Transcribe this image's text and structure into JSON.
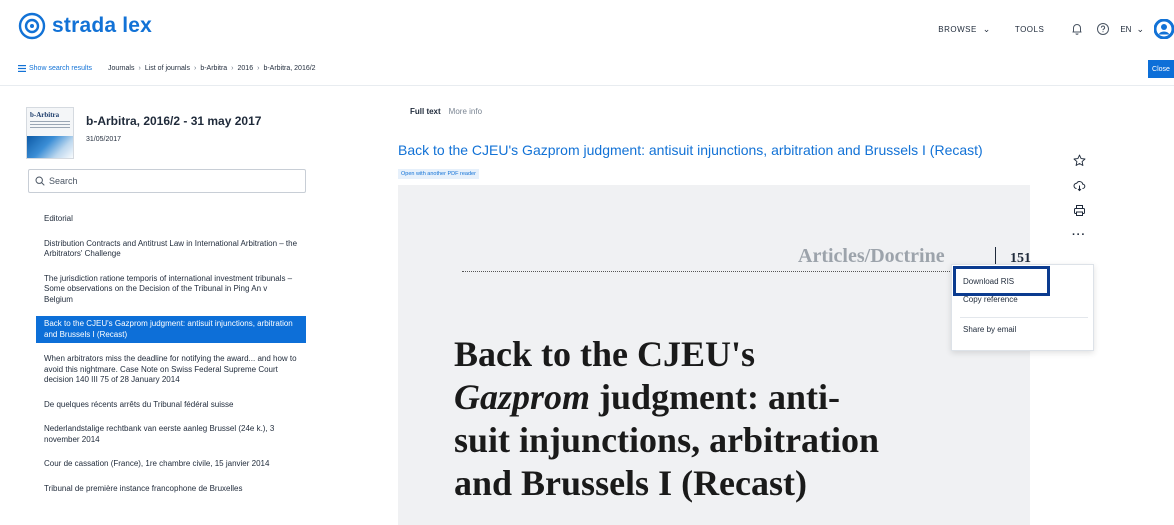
{
  "brand": {
    "name": "strada lex",
    "color": "#1272d6"
  },
  "topnav": {
    "browse": "BROWSE",
    "tools": "TOOLS",
    "language": "EN"
  },
  "breadcrumb": {
    "show_results": "Show search results",
    "items": [
      "Journals",
      "List of journals",
      "b-Arbitra",
      "2016",
      "b-Arbitra, 2016/2"
    ],
    "close_label": "Close"
  },
  "journal": {
    "cover_title": "b-Arbitra",
    "title": "b-Arbitra, 2016/2 - 31 may 2017",
    "date": "31/05/2017"
  },
  "search": {
    "placeholder": "Search"
  },
  "toc": [
    "Editorial",
    "Distribution Contracts and Antitrust Law in International Arbitration – the Arbitrators' Challenge",
    "The jurisdiction ratione temporis of international investment tribunals – Some observations on the Decision of the Tribunal in Ping An v Belgium",
    "Back to the CJEU's Gazprom judgment: antisuit injunctions, arbitration and Brussels I (Recast)",
    "When arbitrators miss the deadline for notifying the award... and how to avoid this nightmare. Case Note on Swiss Federal Supreme Court decision 140 III 75 of 28 January 2014",
    "De quelques récents arrêts du Tribunal fédéral suisse",
    "Nederlandstalige rechtbank van eerste aanleg Brussel (24e k.), 3 november 2014",
    "Cour de cassation (France), 1re chambre civile, 15 janvier 2014",
    "Tribunal de première instance francophone de Bruxelles"
  ],
  "toc_active_index": 3,
  "tabs": {
    "full_text": "Full text",
    "more_info": "More info"
  },
  "document": {
    "title": "Back to the CJEU's Gazprom judgment: antisuit injunctions, arbitration and Brussels I (Recast)",
    "pdf_link": "Open with another PDF reader"
  },
  "pdf_page": {
    "section": "Articles/Doctrine",
    "page_number": "151",
    "title_line1": "Back to the CJEU's",
    "title_line2_italic": "Gazprom",
    "title_line2_rest": " judgment: anti-",
    "title_line3": "suit injunctions, arbitration",
    "title_line4": "and Brussels I (Recast)"
  },
  "actions_menu": {
    "download_ris": "Download RIS",
    "copy_reference": "Copy reference",
    "share_email": "Share by email"
  }
}
